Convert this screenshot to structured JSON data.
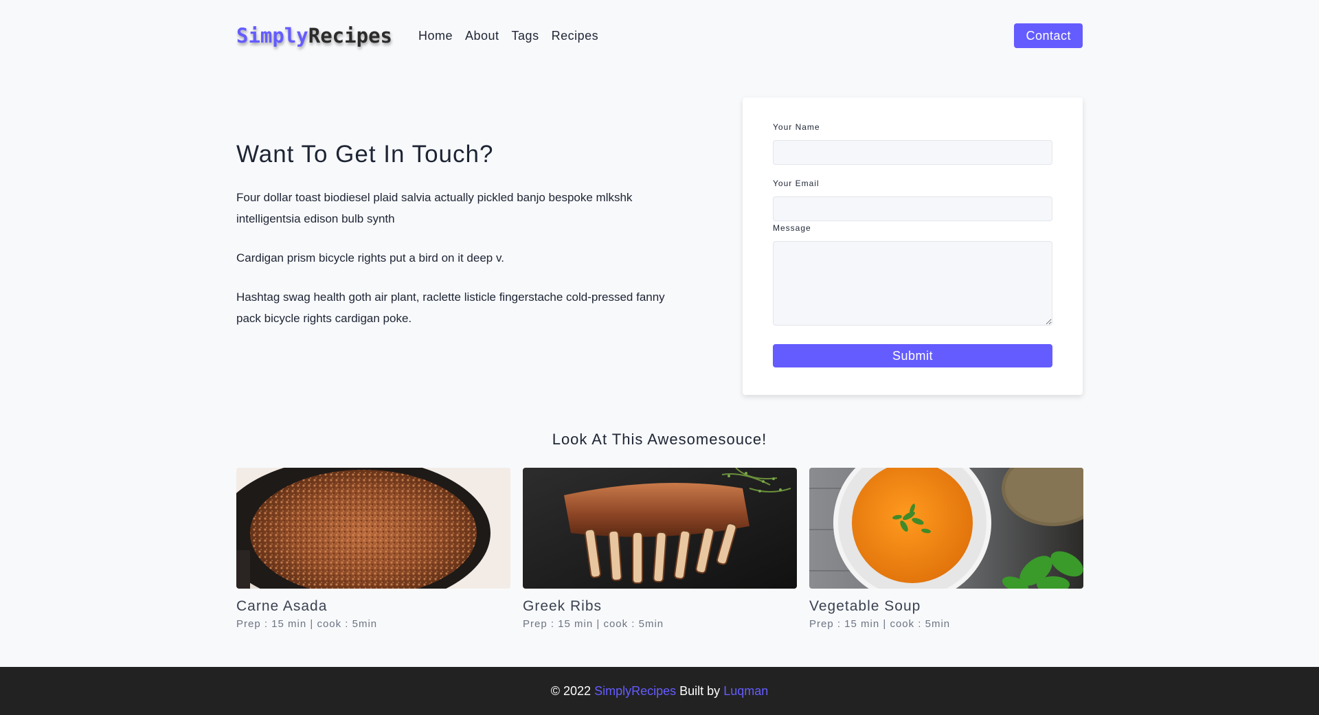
{
  "nav": {
    "logo_part1": "Simply",
    "logo_part2": "Recipes",
    "links": [
      {
        "label": "Home"
      },
      {
        "label": "About"
      },
      {
        "label": "Tags"
      },
      {
        "label": "Recipes"
      }
    ],
    "contact_label": "Contact"
  },
  "intro": {
    "heading": "Want To Get In Touch?",
    "paragraphs": [
      "Four dollar toast biodiesel plaid salvia actually pickled banjo bespoke mlkshk intelligentsia edison bulb synth",
      "Cardigan prism bicycle rights put a bird on it deep v.",
      "Hashtag swag health goth air plant, raclette listicle fingerstache cold-pressed fanny pack bicycle rights cardigan poke."
    ]
  },
  "form": {
    "name_label": "Your Name",
    "name_value": "",
    "email_label": "Your Email",
    "email_value": "",
    "message_label": "Message",
    "message_value": "",
    "submit_label": "Submit"
  },
  "featured": {
    "title": "Look At This Awesomesouce!",
    "recipes": [
      {
        "title": "Carne Asada",
        "meta": "Prep : 15 min | cook : 5min",
        "image": "carne-asada-photo"
      },
      {
        "title": "Greek Ribs",
        "meta": "Prep : 15 min | cook : 5min",
        "image": "greek-ribs-photo"
      },
      {
        "title": "Vegetable Soup",
        "meta": "Prep : 15 min | cook : 5min",
        "image": "vegetable-soup-photo"
      }
    ]
  },
  "footer": {
    "copyright": "© 2022",
    "brand": "SimplyRecipes",
    "built_by": "Built by",
    "author": "Luqman"
  },
  "colors": {
    "accent": "#645cff",
    "background": "#f8f9fb",
    "footer_bg": "#222222",
    "text": "#1d2433"
  }
}
